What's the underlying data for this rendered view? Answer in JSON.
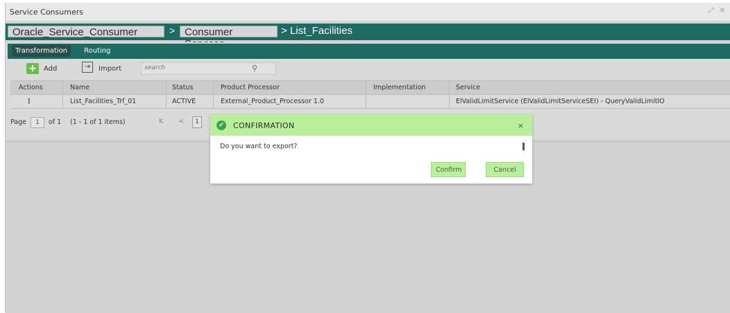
{
  "window": {
    "title": "Service Consumers",
    "icons": [
      "expand-icon",
      "close-icon"
    ]
  },
  "breadcrumb": {
    "items": [
      "Oracle_Service_Consumer",
      "Consumer Services"
    ],
    "separator": ">",
    "current": "> List_Facilities"
  },
  "tabs": [
    {
      "label": "Transformation",
      "active": true
    },
    {
      "label": "Routing",
      "active": false
    }
  ],
  "toolbar": {
    "add_label": "Add",
    "import_label": "Import",
    "search_placeholder": "search"
  },
  "table": {
    "headers": [
      "Actions",
      "Name",
      "Status",
      "Product Processor",
      "Implementation",
      "Service"
    ],
    "rows": [
      {
        "actions": "⋮",
        "name": "List_Facilities_Trf_01",
        "status": "ACTIVE",
        "product_processor": "External_Product_Processor 1.0",
        "implementation": "",
        "service": "ElValidLimitService (ElValidLimitServiceSEI) - QueryValidLimitIO"
      }
    ]
  },
  "pager": {
    "page_label": "Page",
    "page_value": "1",
    "of_text": "of 1",
    "items_text": "(1 - 1 of 1 items)",
    "first": "K",
    "prev": "<",
    "current": "1"
  },
  "dialog": {
    "title": "CONFIRMATION",
    "close": "×",
    "message": "Do you want to export?",
    "confirm_label": "Confirm",
    "cancel_label": "Cancel"
  },
  "colors": {
    "brand": "#1d6b63",
    "dialog_header": "#b9f09b",
    "success": "#3aa54a"
  }
}
